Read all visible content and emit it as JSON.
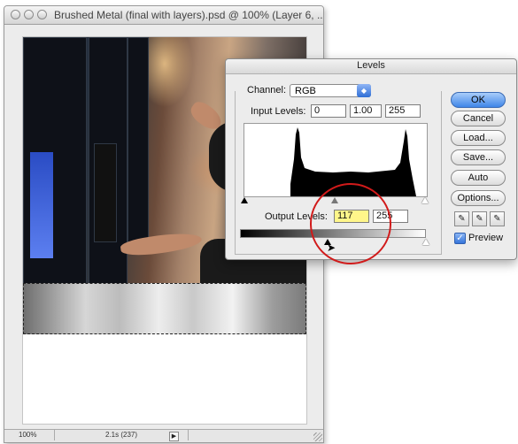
{
  "document": {
    "title": "Brushed Metal (final with layers).psd @ 100% (Layer 6, ...",
    "status_zoom": "100%",
    "status_info": "2.1s (237)"
  },
  "levels": {
    "title": "Levels",
    "channel_label": "Channel:",
    "channel_value": "RGB",
    "input_label": "Input Levels:",
    "input_black": "0",
    "input_gamma": "1.00",
    "input_white": "255",
    "output_label": "Output Levels:",
    "output_black": "117",
    "output_white": "255",
    "buttons": {
      "ok": "OK",
      "cancel": "Cancel",
      "load": "Load...",
      "save": "Save...",
      "auto": "Auto",
      "options": "Options..."
    },
    "preview_label": "Preview",
    "preview_checked": true,
    "accent_color": "#3f86e8",
    "highlight_field_color": "#fff68a",
    "annotation_color": "#d11a1a"
  }
}
